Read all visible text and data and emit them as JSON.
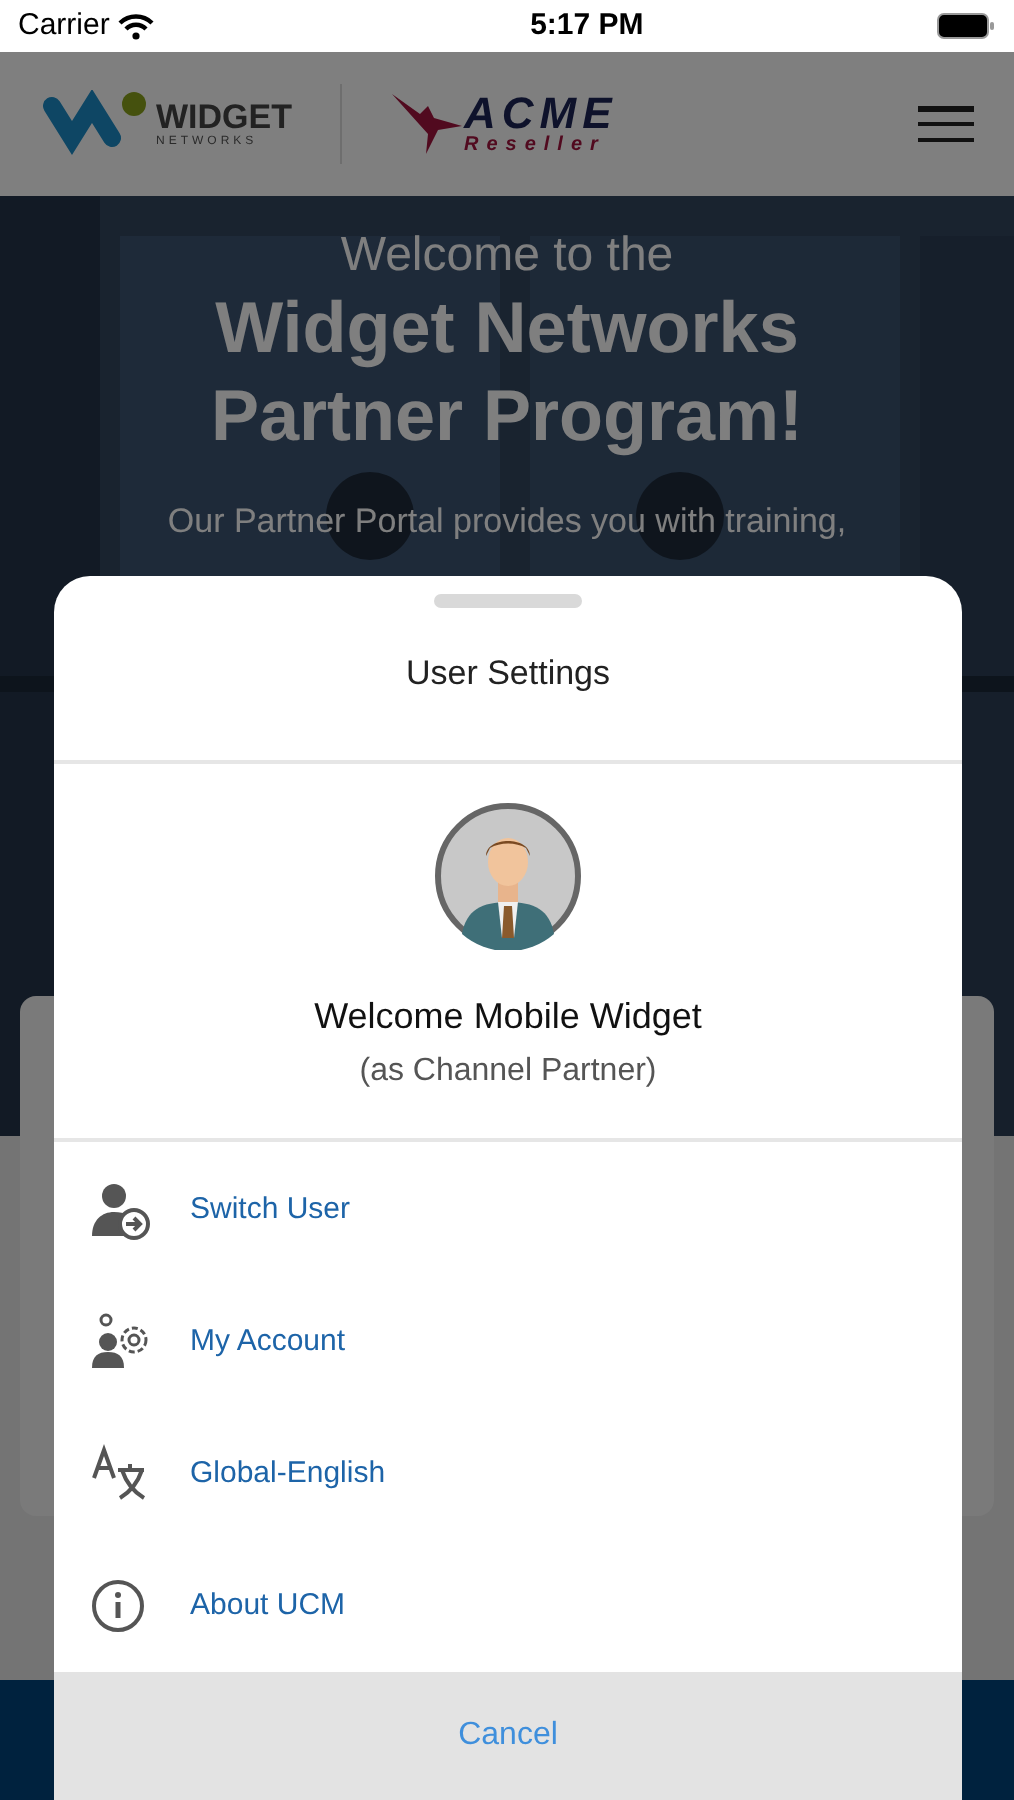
{
  "status_bar": {
    "carrier": "Carrier",
    "time": "5:17 PM"
  },
  "header": {
    "brand": {
      "name": "WIDGET",
      "sub": "NETWORKS"
    },
    "partner": {
      "name": "ACME",
      "sub": "Reseller"
    }
  },
  "hero": {
    "kicker": "Welcome to the",
    "title_lines": [
      "Widget Networks",
      "Partner Program!"
    ],
    "text": "Our Partner Portal provides you with training,"
  },
  "sheet": {
    "title": "User Settings",
    "user": {
      "name": "Welcome Mobile Widget",
      "role": "(as Channel Partner)"
    },
    "items": [
      {
        "kind": "switch-user",
        "label": "Switch User"
      },
      {
        "kind": "account",
        "label": "My Account"
      },
      {
        "kind": "language",
        "label": "Global-English"
      },
      {
        "kind": "about",
        "label": "About UCM"
      }
    ],
    "cancel": "Cancel"
  }
}
